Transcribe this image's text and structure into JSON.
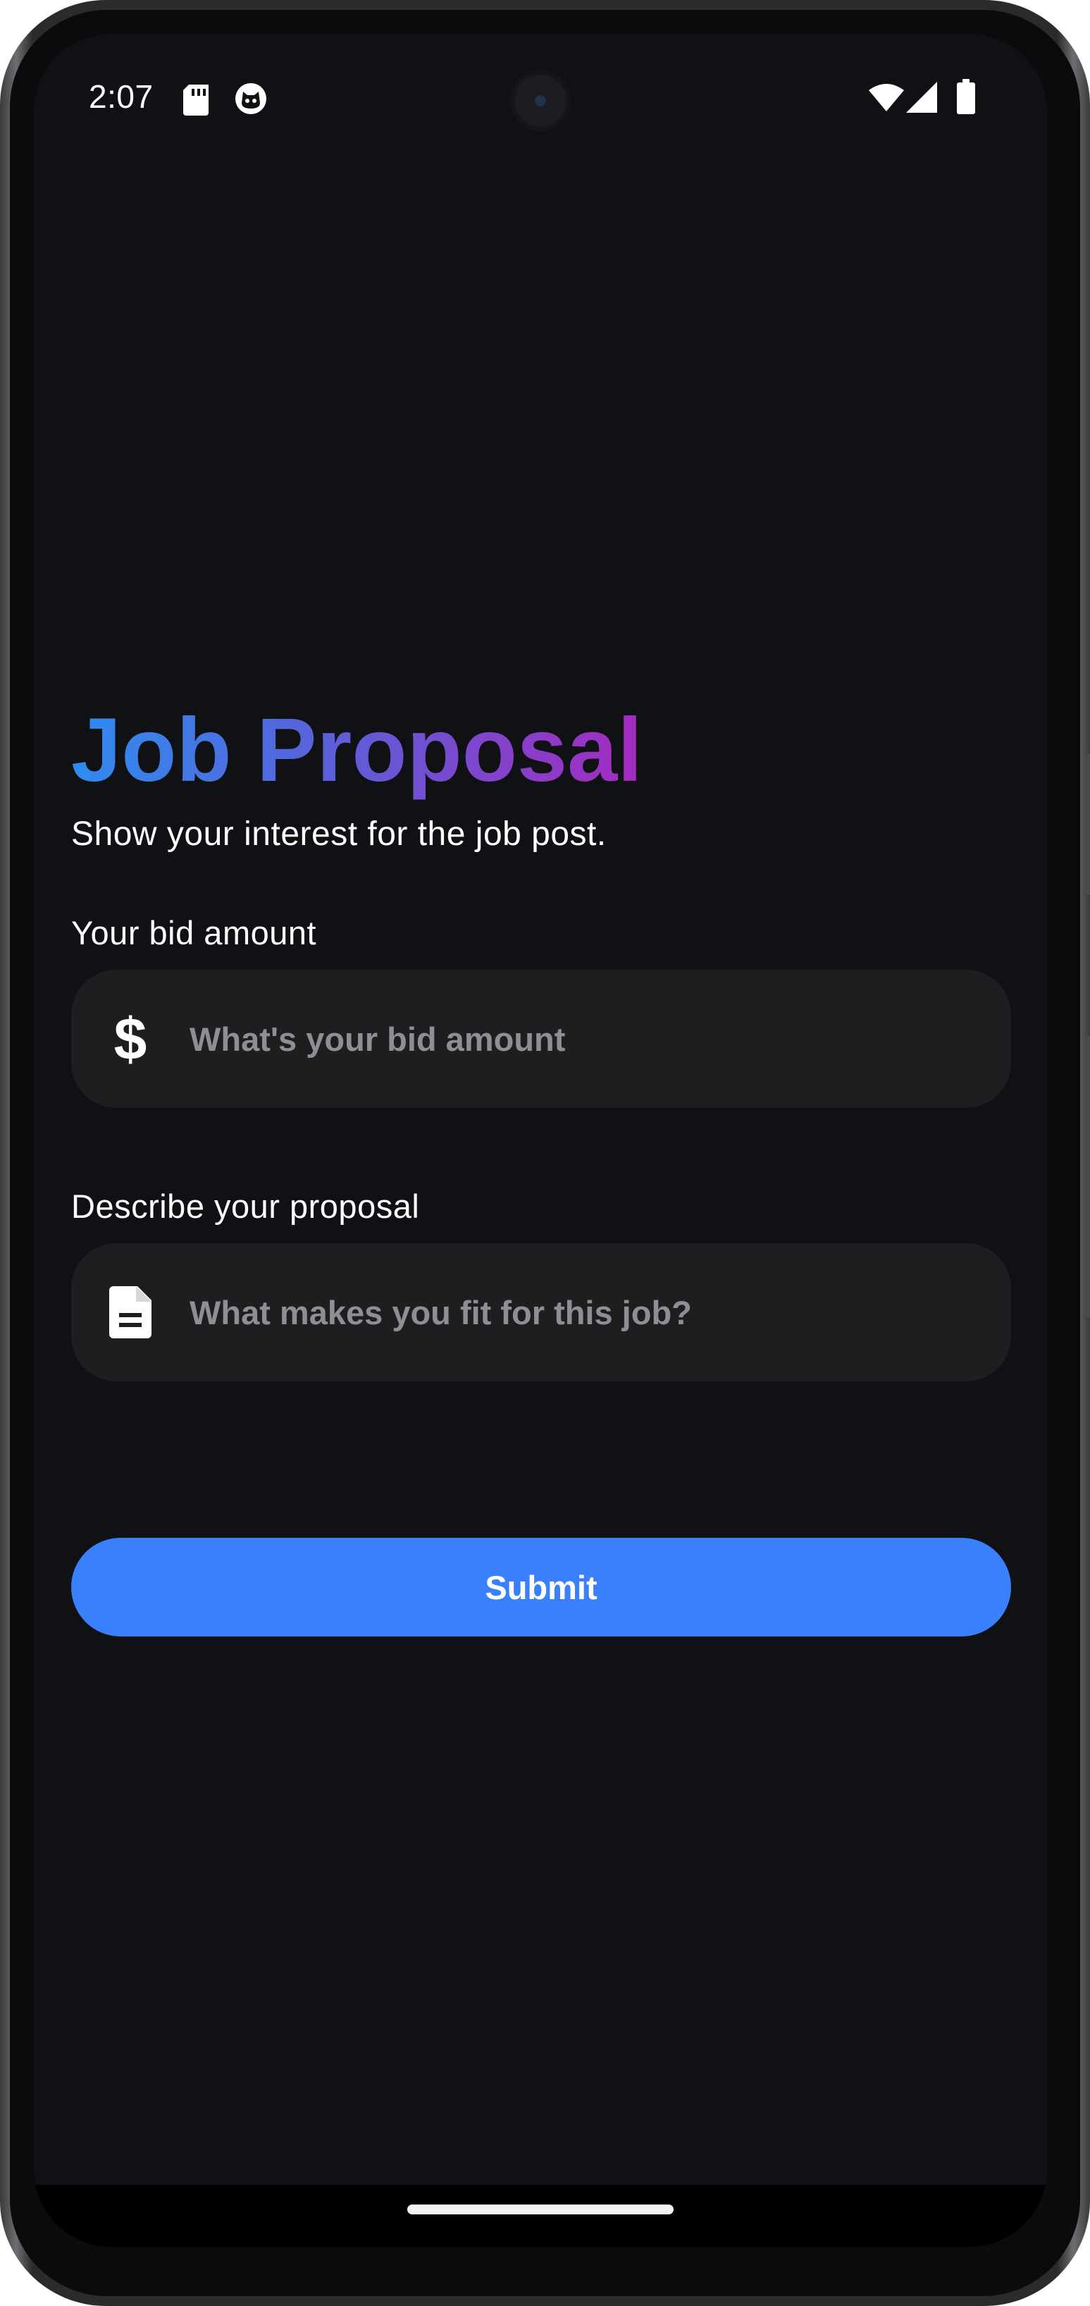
{
  "status_bar": {
    "time": "2:07",
    "icons": [
      "sd-card-icon",
      "cat-notification-icon",
      "wifi-icon",
      "cell-signal-icon",
      "battery-icon"
    ]
  },
  "header": {
    "title": "Job Proposal",
    "subtitle": "Show your interest for the job post."
  },
  "form": {
    "bid": {
      "label": "Your bid amount",
      "icon": "dollar-icon",
      "value": "",
      "placeholder": "What's your bid amount"
    },
    "proposal": {
      "label": "Describe your proposal",
      "icon": "document-icon",
      "value": "",
      "placeholder": "What makes you fit for this job?"
    },
    "submit_label": "Submit"
  },
  "colors": {
    "background": "#101115",
    "field_background": "#1e1e20",
    "accent": "#3a80fa",
    "title_gradient": [
      "#2f8cf0",
      "#5b60d8",
      "#a52ac0"
    ],
    "placeholder": "#8f8f93"
  }
}
